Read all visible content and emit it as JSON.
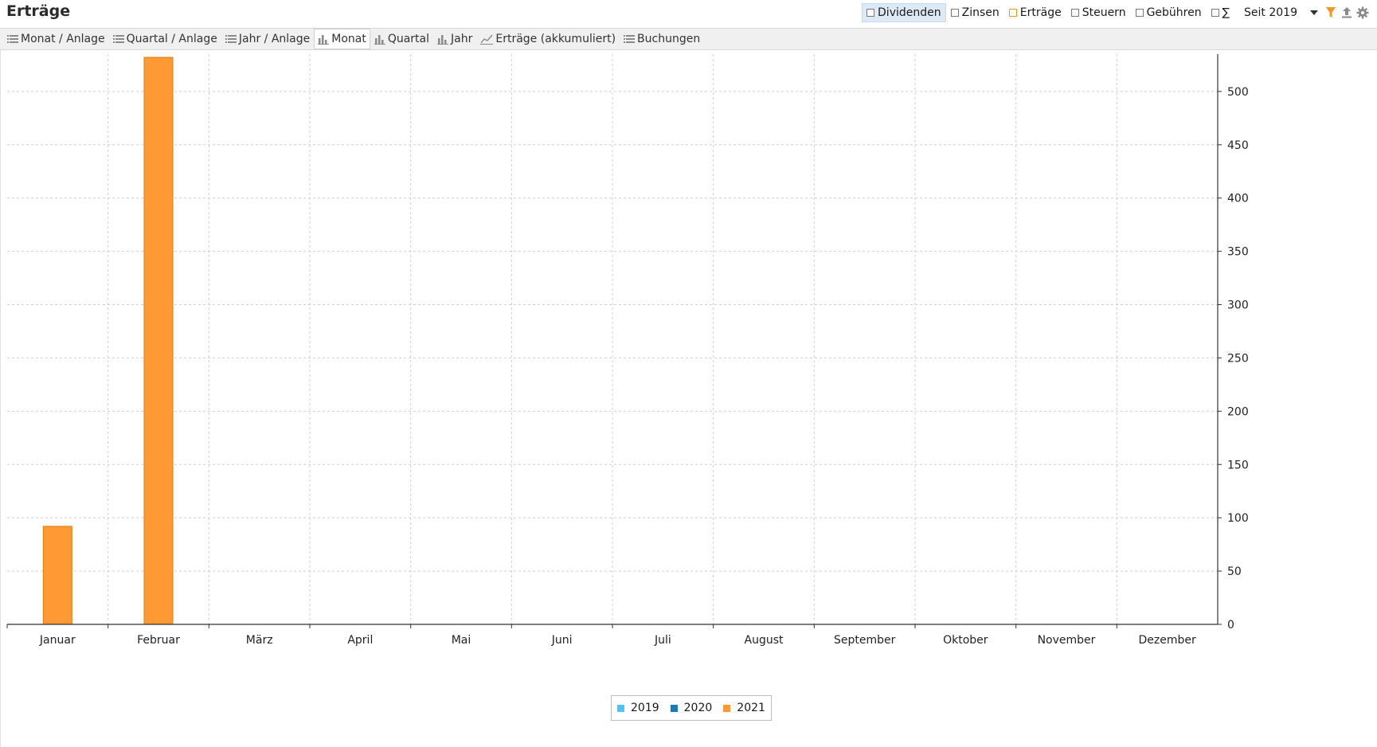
{
  "header": {
    "title": "Erträge",
    "filters": [
      {
        "label": "Dividenden",
        "active": true
      },
      {
        "label": "Zinsen",
        "active": false
      },
      {
        "label": "Erträge",
        "active": false
      },
      {
        "label": "Steuern",
        "active": false
      },
      {
        "label": "Gebühren",
        "active": false
      },
      {
        "label": "∑",
        "active": false
      }
    ],
    "period": "Seit 2019",
    "icons": [
      "filter-icon",
      "export-icon",
      "settings-icon"
    ]
  },
  "tabs": [
    {
      "label": "Monat / Anlage",
      "icon": "table-icon",
      "selected": false
    },
    {
      "label": "Quartal / Anlage",
      "icon": "table-icon",
      "selected": false
    },
    {
      "label": "Jahr / Anlage",
      "icon": "table-icon",
      "selected": false
    },
    {
      "label": "Monat",
      "icon": "bar-chart-icon",
      "selected": true
    },
    {
      "label": "Quartal",
      "icon": "bar-chart-icon",
      "selected": false
    },
    {
      "label": "Jahr",
      "icon": "bar-chart-icon",
      "selected": false
    },
    {
      "label": "Erträge (akkumuliert)",
      "icon": "line-chart-icon",
      "selected": false
    },
    {
      "label": "Buchungen",
      "icon": "table-icon",
      "selected": false
    }
  ],
  "colors": {
    "accent": "#f7941d",
    "series_2019": "#4fc3f7",
    "series_2020": "#1f77b4",
    "series_2021": "#ff9933",
    "grid": "#d0d0d0"
  },
  "chart_data": {
    "type": "bar",
    "categories": [
      "Januar",
      "Februar",
      "März",
      "April",
      "Mai",
      "Juni",
      "Juli",
      "August",
      "September",
      "Oktober",
      "November",
      "Dezember"
    ],
    "series": [
      {
        "name": "2019",
        "color": "#4fc3f7",
        "values": [
          0,
          0,
          0,
          0,
          0,
          0,
          0,
          0,
          0,
          0,
          0,
          0
        ]
      },
      {
        "name": "2020",
        "color": "#1f77b4",
        "values": [
          0,
          0,
          0,
          0,
          0,
          0,
          0,
          0,
          0,
          0,
          0,
          0
        ]
      },
      {
        "name": "2021",
        "color": "#ff9933",
        "values": [
          92,
          532,
          0,
          0,
          0,
          0,
          0,
          0,
          0,
          0,
          0,
          0
        ]
      }
    ],
    "ylim": [
      0,
      535
    ],
    "yticks": [
      0,
      50,
      100,
      150,
      200,
      250,
      300,
      350,
      400,
      450,
      500
    ],
    "y_axis_position": "right",
    "grid": true,
    "legend": "bottom-center"
  }
}
